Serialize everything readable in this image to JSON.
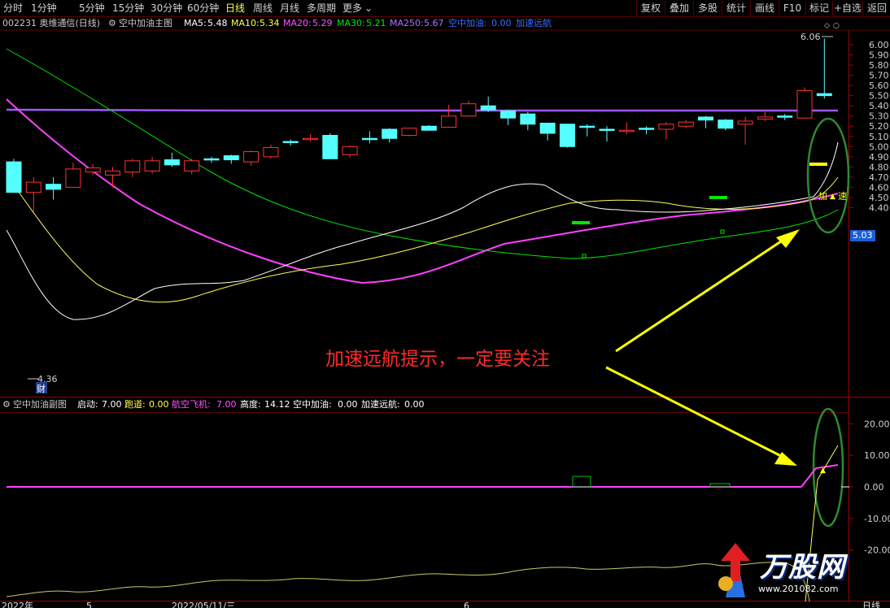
{
  "toolbar": {
    "periods": [
      "分时",
      "1分钟",
      "5分钟",
      "15分钟",
      "30分钟",
      "60分钟",
      "日线",
      "周线",
      "月线",
      "多周期",
      "更多"
    ],
    "active": "日线",
    "right_buttons": [
      "复权",
      "叠加",
      "多股",
      "统计",
      "画线",
      "F10",
      "标记",
      "+自选",
      "返回"
    ]
  },
  "main_legend": {
    "code_name": "002231 奥维通信(日线)",
    "indicator": "空中加油主图",
    "ma5_label": "MA5:",
    "ma5": "5.48",
    "ma10_label": "MA10:",
    "ma10": "5.34",
    "ma20_label": "MA20:",
    "ma20": "5.29",
    "ma30_label": "MA30:",
    "ma30": "5.21",
    "ma250_label": "MA250:",
    "ma250": "5.67",
    "kz_label": "空中加油:",
    "kz": "0.00",
    "js_label": "加速远航"
  },
  "sub_legend": {
    "indicator": "空中加油副图",
    "qd_label": "启动:",
    "qd": "7.00",
    "pd_label": "跑道:",
    "pd": "0.00",
    "hk_label": "航空飞机:",
    "hk": "7.00",
    "gd_label": "高度:",
    "gd": "14.12",
    "kz_label": "空中加油:",
    "kz": "0.00",
    "js_label": "加速远航:",
    "js": "0.00"
  },
  "price_axis": [
    "6.00",
    "5.90",
    "5.80",
    "5.70",
    "5.60",
    "5.50",
    "5.40",
    "5.30",
    "5.20",
    "5.10",
    "5.00",
    "4.90",
    "4.80",
    "4.70",
    "4.60",
    "4.50",
    "4.40"
  ],
  "sub_axis": [
    "20.00",
    "10.00",
    "0.00",
    "-10.00",
    "-20.00"
  ],
  "current_price": "5.03",
  "high_mark": "6.06",
  "low_mark": "4.36",
  "cai_badge": "财",
  "signal_jia": "加",
  "signal_su": "速",
  "annotation": "加速远航提示，一定要关注",
  "date_labels": [
    "2022年",
    "5",
    "2022/05/11/三",
    "6"
  ],
  "bottom_right": "日线",
  "logo": {
    "text": "万股网",
    "url": "www.201082.com"
  },
  "colors": {
    "up": "#ff3232",
    "down": "#54ffff",
    "ma5": "#ffffff",
    "ma10": "#ffff54",
    "ma20": "#ff54ff",
    "ma30": "#00e600",
    "ma250": "#9b59ff",
    "arrow": "#ffff00"
  },
  "chart_data": {
    "type": "candlestick",
    "title": "空中加油主图",
    "ylim": [
      4.36,
      6.06
    ],
    "candles": [
      {
        "o": 4.85,
        "c": 4.55,
        "h": 4.88,
        "l": 4.55
      },
      {
        "o": 4.55,
        "c": 4.65,
        "h": 4.7,
        "l": 4.36
      },
      {
        "o": 4.63,
        "c": 4.58,
        "h": 4.7,
        "l": 4.48
      },
      {
        "o": 4.6,
        "c": 4.78,
        "h": 4.84,
        "l": 4.6
      },
      {
        "o": 4.75,
        "c": 4.79,
        "h": 4.83,
        "l": 4.72
      },
      {
        "o": 4.72,
        "c": 4.76,
        "h": 4.8,
        "l": 4.6
      },
      {
        "o": 4.75,
        "c": 4.86,
        "h": 4.88,
        "l": 4.7
      },
      {
        "o": 4.76,
        "c": 4.86,
        "h": 4.9,
        "l": 4.73
      },
      {
        "o": 4.87,
        "c": 4.82,
        "h": 4.94,
        "l": 4.8
      },
      {
        "o": 4.76,
        "c": 4.86,
        "h": 4.88,
        "l": 4.73
      },
      {
        "o": 4.88,
        "c": 4.87,
        "h": 4.9,
        "l": 4.84
      },
      {
        "o": 4.91,
        "c": 4.87,
        "h": 4.92,
        "l": 4.83
      },
      {
        "o": 4.85,
        "c": 4.95,
        "h": 4.96,
        "l": 4.81
      },
      {
        "o": 4.9,
        "c": 4.99,
        "h": 5.02,
        "l": 4.88
      },
      {
        "o": 5.05,
        "c": 5.04,
        "h": 5.07,
        "l": 5.01
      },
      {
        "o": 5.07,
        "c": 5.08,
        "h": 5.12,
        "l": 5.05
      },
      {
        "o": 5.11,
        "c": 4.88,
        "h": 5.13,
        "l": 4.88
      },
      {
        "o": 4.92,
        "c": 5.0,
        "h": 5.01,
        "l": 4.89
      },
      {
        "o": 5.08,
        "c": 5.07,
        "h": 5.15,
        "l": 5.03
      },
      {
        "o": 5.17,
        "c": 5.08,
        "h": 5.18,
        "l": 5.04
      },
      {
        "o": 5.11,
        "c": 5.18,
        "h": 5.18,
        "l": 5.1
      },
      {
        "o": 5.2,
        "c": 5.16,
        "h": 5.21,
        "l": 5.16
      },
      {
        "o": 5.19,
        "c": 5.3,
        "h": 5.41,
        "l": 5.19
      },
      {
        "o": 5.3,
        "c": 5.42,
        "h": 5.45,
        "l": 5.3
      },
      {
        "o": 5.4,
        "c": 5.36,
        "h": 5.49,
        "l": 5.34
      },
      {
        "o": 5.35,
        "c": 5.28,
        "h": 5.36,
        "l": 5.21
      },
      {
        "o": 5.32,
        "c": 5.22,
        "h": 5.34,
        "l": 5.16
      },
      {
        "o": 5.23,
        "c": 5.13,
        "h": 5.23,
        "l": 5.06
      },
      {
        "o": 5.22,
        "c": 5.0,
        "h": 5.22,
        "l": 4.99
      },
      {
        "o": 5.2,
        "c": 5.19,
        "h": 5.22,
        "l": 5.1
      },
      {
        "o": 5.17,
        "c": 5.16,
        "h": 5.2,
        "l": 5.05
      },
      {
        "o": 5.16,
        "c": 5.16,
        "h": 5.24,
        "l": 5.12
      },
      {
        "o": 5.18,
        "c": 5.17,
        "h": 5.2,
        "l": 5.12
      },
      {
        "o": 5.17,
        "c": 5.22,
        "h": 5.24,
        "l": 5.07
      },
      {
        "o": 5.2,
        "c": 5.24,
        "h": 5.26,
        "l": 5.18
      },
      {
        "o": 5.29,
        "c": 5.26,
        "h": 5.3,
        "l": 5.18
      },
      {
        "o": 5.26,
        "c": 5.18,
        "h": 5.27,
        "l": 5.16
      },
      {
        "o": 5.22,
        "c": 5.25,
        "h": 5.29,
        "l": 5.02
      },
      {
        "o": 5.27,
        "c": 5.29,
        "h": 5.36,
        "l": 5.25
      },
      {
        "o": 5.3,
        "c": 5.29,
        "h": 5.32,
        "l": 5.26
      },
      {
        "o": 5.28,
        "c": 5.55,
        "h": 5.58,
        "l": 5.28
      },
      {
        "o": 5.52,
        "c": 5.5,
        "h": 6.06,
        "l": 5.47
      }
    ]
  }
}
